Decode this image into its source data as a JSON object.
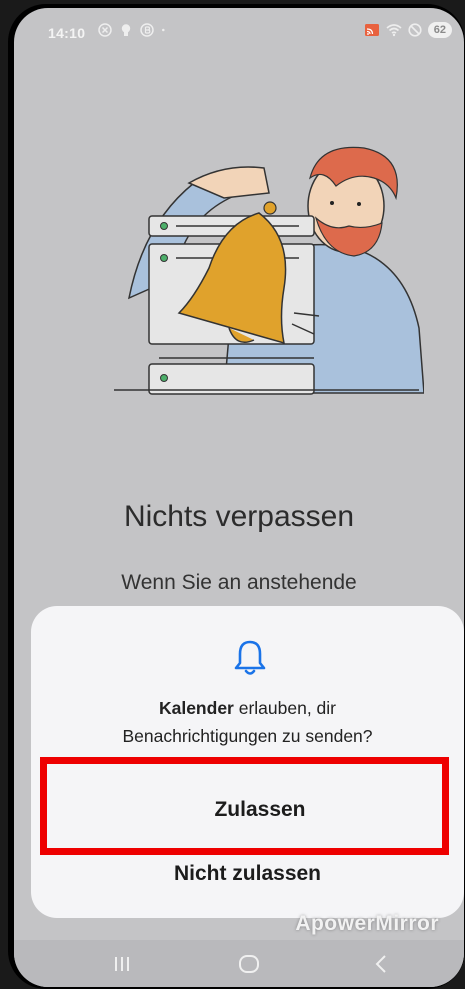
{
  "status_bar": {
    "time": "14:10",
    "left_icons": [
      "circle-x-icon",
      "bulb-icon",
      "circle-b-icon",
      "dot-icon"
    ],
    "right_icons": [
      "cast-icon",
      "wifi-icon",
      "do-not-disturb-icon"
    ],
    "battery": "62"
  },
  "screen": {
    "title": "Nichts verpassen",
    "subtitle": "Wenn Sie an anstehende"
  },
  "dialog": {
    "icon": "bell-icon",
    "app_name": "Kalender",
    "message_rest": " erlauben, dir",
    "message_line2": "Benachrichtigungen zu senden?",
    "allow_label": "Zulassen",
    "deny_label": "Nicht zulassen"
  },
  "watermark": "ApowerMirror",
  "colors": {
    "highlight": "#ee0000",
    "bell_accent": "#1a73e8",
    "background": "#c4c4c6"
  }
}
